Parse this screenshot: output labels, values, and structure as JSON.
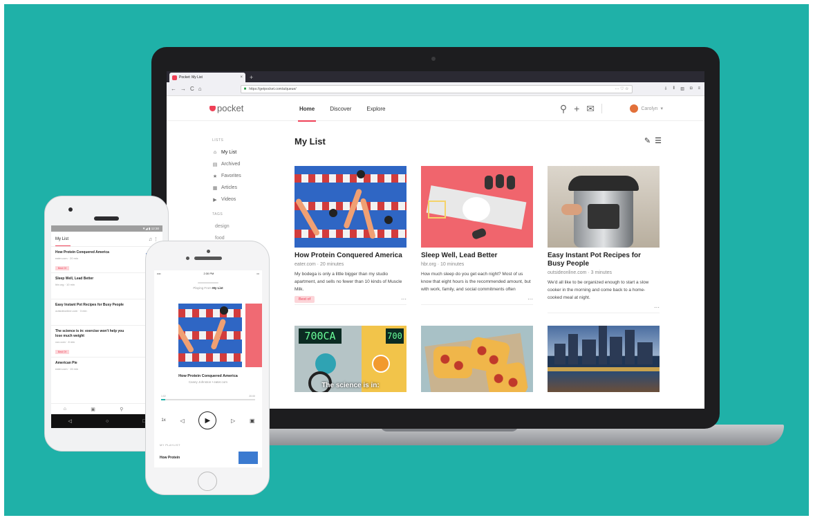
{
  "browser": {
    "tab_title": "Pocket: My List",
    "tab_close": "×",
    "new_tab": "+",
    "url": "https://getpocket.com/a/queue/",
    "url_tools": "··· ♡ ☆",
    "back": "←",
    "forward": "→",
    "reload": "C",
    "home": "⌂"
  },
  "pocket": {
    "logo": "pocket",
    "nav": {
      "home": "Home",
      "discover": "Discover",
      "explore": "Explore"
    },
    "user": "Carolyn",
    "sidebar": {
      "lists_heading": "LISTS",
      "items": [
        {
          "label": "My List",
          "icon": "home-icon"
        },
        {
          "label": "Archived",
          "icon": "archive-icon"
        },
        {
          "label": "Favorites",
          "icon": "star-icon"
        },
        {
          "label": "Articles",
          "icon": "article-icon"
        },
        {
          "label": "Videos",
          "icon": "video-icon"
        }
      ],
      "tags_heading": "TAGS",
      "tags": [
        "design",
        "food"
      ]
    },
    "main_title": "My List",
    "cards": [
      {
        "title": "How Protein Conquered America",
        "meta": "eater.com · 20 minutes",
        "excerpt": "My bodega is only a little bigger than my studio apartment, and sells no fewer than 10 kinds of Muscle Milk.",
        "badge": "Best of"
      },
      {
        "title": "Sleep Well, Lead Better",
        "meta": "hbr.org · 10 minutes",
        "excerpt": "How much sleep do you get each night? Most of us know that eight hours is the recommended amount, but with work, family, and social commitments often consuming",
        "badge": ""
      },
      {
        "title": "Easy Instant Pot Recipes for Busy People",
        "meta": "outsideonline.com · 3 minutes",
        "excerpt": "We'd all like to be organized enough to start a slow cooker in the morning and come back to a home-cooked meal at night.",
        "badge": ""
      }
    ],
    "card_more": "···",
    "bike_display": "700CA",
    "bike_display2": "700",
    "bike_caption": "The science is in:"
  },
  "android": {
    "status": "▼◢ ▮ 12:30",
    "title": "My List",
    "items": [
      {
        "title": "How Protein Conquered America",
        "meta": "eater.com · 20 min",
        "badge": "Best Of"
      },
      {
        "title": "Sleep Well, Lead Better",
        "meta": "hbr.org · 10 min",
        "badge": ""
      },
      {
        "title": "Easy Instant Pot Recipes for Busy People",
        "meta": "outsideonline.com · 3 min",
        "badge": ""
      },
      {
        "title": "The science is in: exercise won't help you lose much weight",
        "meta": "vox.com · 8 min",
        "badge": "Best Of"
      },
      {
        "title": "American Pie",
        "meta": "eater.com · 15 min",
        "badge": ""
      }
    ]
  },
  "iphone": {
    "carrier": "•••• ",
    "time": "2:30 PM",
    "playing_prefix": "Playing From",
    "playing_list": "My List",
    "song_title": "How Protein Conquered America",
    "song_sub": "Casey Johnston • eater.com",
    "time_elapsed": "1:02",
    "time_total": "20:00",
    "speed": "1x",
    "playlist_heading": "MY PLAYLIST",
    "playlist_item": "How Protein"
  },
  "colors": {
    "background": "#1fb1a8",
    "pocket_red": "#ef4056"
  }
}
